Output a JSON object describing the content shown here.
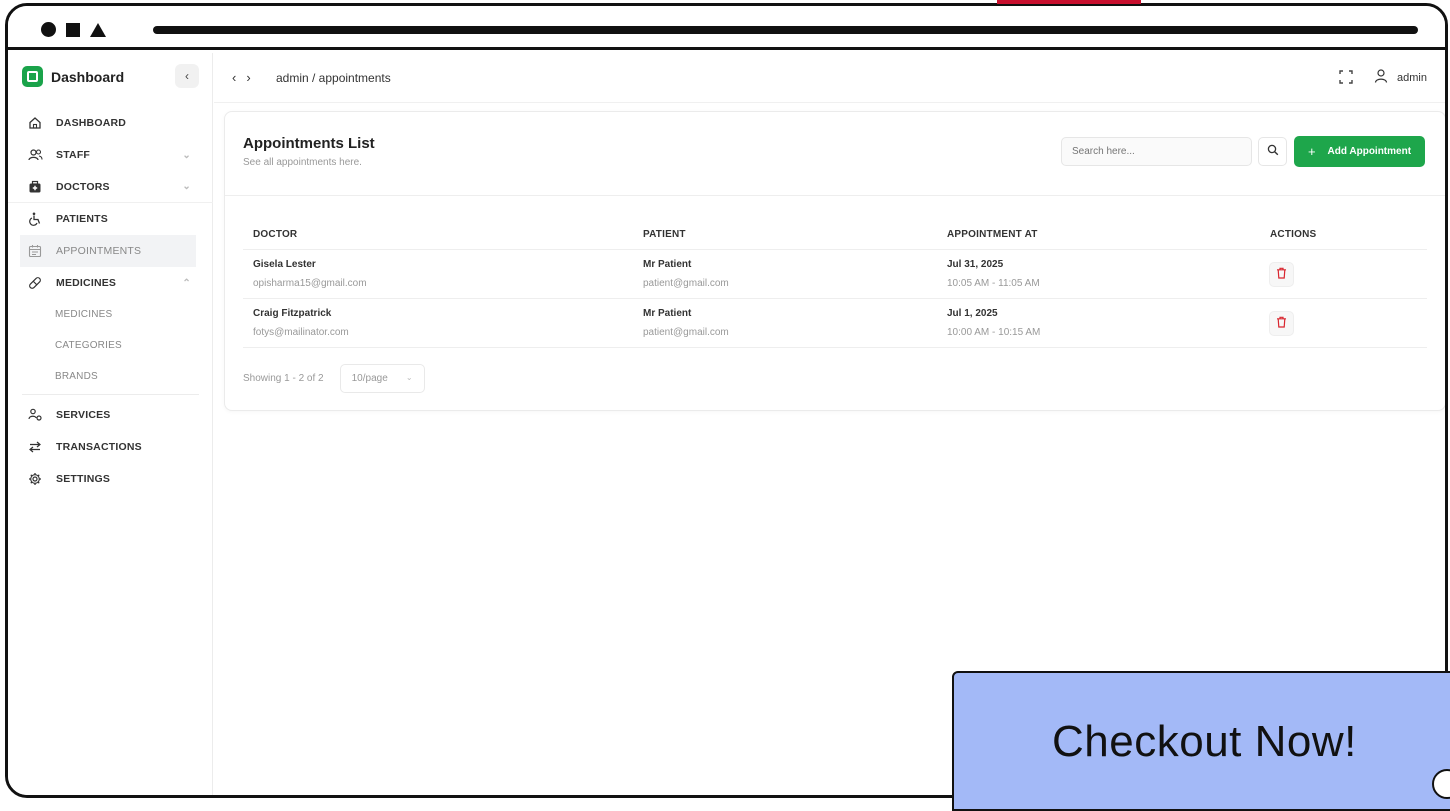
{
  "sidebar": {
    "brand": "Dashboard",
    "collapse_glyph": "‹",
    "items": [
      {
        "label": "DASHBOARD",
        "icon": "home-icon"
      },
      {
        "label": "STAFF",
        "icon": "users-icon",
        "expandable": true
      },
      {
        "label": "DOCTORS",
        "icon": "doctor-bag-icon",
        "expandable": true
      },
      {
        "label": "PATIENTS",
        "icon": "wheelchair-icon"
      },
      {
        "label": "APPOINTMENTS",
        "icon": "calendar-icon",
        "active": true
      },
      {
        "label": "MEDICINES",
        "icon": "pill-icon",
        "expanded": true
      }
    ],
    "medicine_subitems": [
      "MEDICINES",
      "CATEGORIES",
      "BRANDS"
    ],
    "bottom_items": [
      {
        "label": "SERVICES",
        "icon": "services-icon"
      },
      {
        "label": "TRANSACTIONS",
        "icon": "transfer-icon"
      },
      {
        "label": "SETTINGS",
        "icon": "gear-icon"
      }
    ]
  },
  "topbar": {
    "breadcrumb": "admin / appointments",
    "user_name": "admin"
  },
  "card": {
    "title": "Appointments List",
    "subtitle": "See all appointments here.",
    "search_placeholder": "Search here...",
    "add_button": "Add Appointment"
  },
  "table": {
    "headers": [
      "DOCTOR",
      "PATIENT",
      "APPOINTMENT AT",
      "ACTIONS"
    ],
    "rows": [
      {
        "doctor_name": "Gisela Lester",
        "doctor_email": "opisharma15@gmail.com",
        "patient_name": "Mr Patient",
        "patient_email": "patient@gmail.com",
        "date": "Jul 31, 2025",
        "time": "10:05 AM - 11:05 AM"
      },
      {
        "doctor_name": "Craig Fitzpatrick",
        "doctor_email": "fotys@mailinator.com",
        "patient_name": "Mr Patient",
        "patient_email": "patient@gmail.com",
        "date": "Jul 1, 2025",
        "time": "10:00 AM - 10:15 AM"
      }
    ]
  },
  "pagination": {
    "showing": "Showing 1 - 2 of 2",
    "per_page": "10/page"
  },
  "overlay": {
    "text": "Checkout Now!"
  },
  "colors": {
    "accent_green": "#1ea64b",
    "delete_red": "#d9262f",
    "overlay_blue": "#a3b9f7"
  }
}
